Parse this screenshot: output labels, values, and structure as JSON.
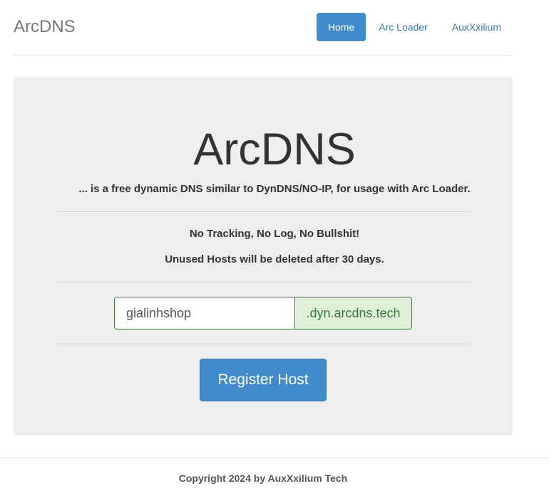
{
  "header": {
    "brand": "ArcDNS",
    "nav": [
      {
        "label": "Home",
        "active": true
      },
      {
        "label": "Arc Loader",
        "active": false
      },
      {
        "label": "AuxXxilium",
        "active": false
      }
    ]
  },
  "main": {
    "title": "ArcDNS",
    "lead": "... is a free dynamic DNS similar to DynDNS/NO-IP, for usage with Arc Loader.",
    "line1": "No Tracking, No Log, No Bullshit!",
    "line2": "Unused Hosts will be deleted after 30 days.",
    "host_input_value": "gialinhshop",
    "host_suffix": ".dyn.arcdns.tech",
    "register_label": "Register Host"
  },
  "footer": {
    "copyright": "Copyright 2024 by AuxXxilium Tech"
  },
  "colors": {
    "primary": "#428bca",
    "success_bg": "#dff0d8",
    "success_text": "#3c763d",
    "jumbotron_bg": "#eeeeee"
  }
}
